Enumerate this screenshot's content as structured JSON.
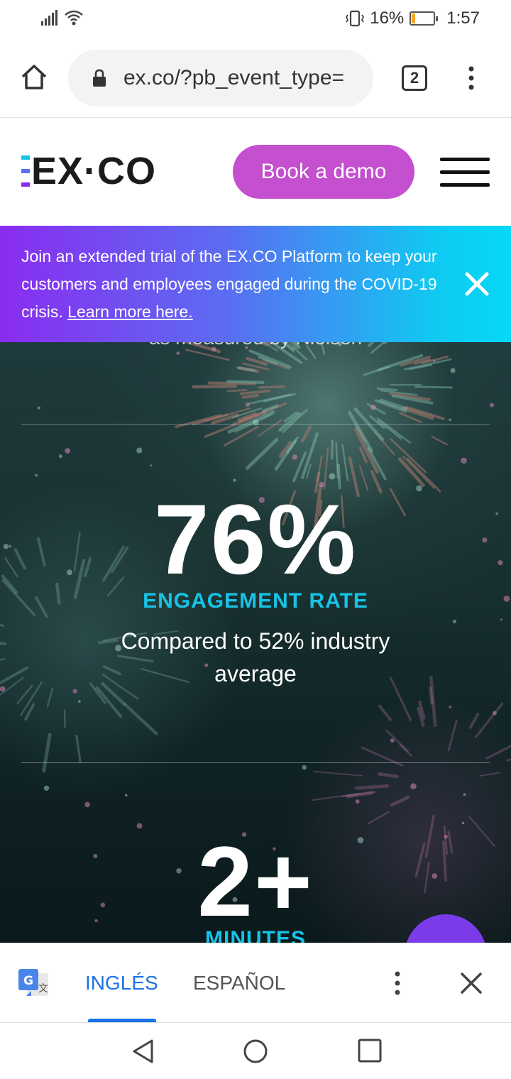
{
  "status_bar": {
    "battery_percent": "16%",
    "battery_level": 0.16,
    "time": "1:57"
  },
  "browser": {
    "url": "ex.co/?pb_event_type=",
    "tab_count": "2"
  },
  "site_header": {
    "logo_text": "EX·CO",
    "book_demo_label": "Book a demo"
  },
  "banner": {
    "text": "Join an extended trial of the EX.CO Platform to keep your customers and employees engaged during the COVID-19 crisis. ",
    "link_text": "Learn more here."
  },
  "hero": {
    "cut_off_text": "as measured by Nielsen",
    "stats": [
      {
        "value": "76%",
        "label": "ENGAGEMENT RATE",
        "description": "Compared to 52% industry average"
      },
      {
        "value": "2+",
        "label": "MINUTES"
      }
    ]
  },
  "translate_bar": {
    "source_lang": "INGLÉS",
    "target_lang": "ESPAÑOL"
  },
  "colors": {
    "accent_button": "#c44fcf",
    "stat_label": "#17c3e6",
    "banner_start": "#8a2cf0",
    "banner_end": "#06d8f6",
    "translate_active": "#1a73e8"
  },
  "icons": {
    "signal": "signal-icon",
    "wifi": "wifi-icon",
    "vibrate": "vibrate-icon",
    "battery": "battery-icon",
    "home": "home-icon",
    "lock": "lock-icon",
    "tabs": "tabs-icon",
    "menu": "more-vert-icon",
    "hamburger": "hamburger-menu-icon",
    "close": "close-icon",
    "translate": "google-translate-icon",
    "nav_back": "back-icon",
    "nav_home": "nav-home-icon",
    "nav_recent": "recent-apps-icon"
  }
}
